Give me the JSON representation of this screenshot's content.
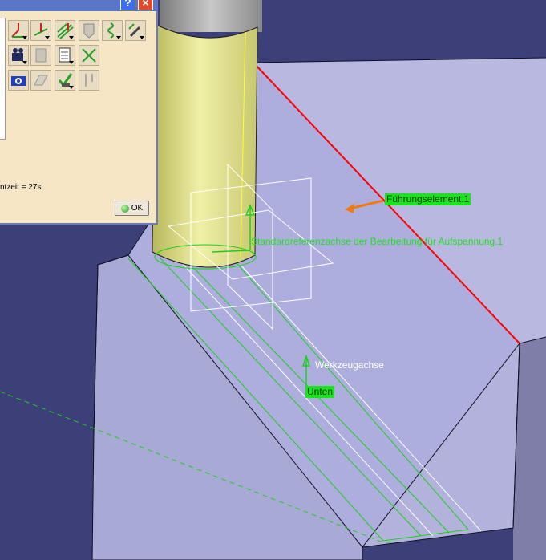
{
  "viewport": {
    "labels": {
      "guide_element": "Führungselement.1",
      "reference_axis": "Standardreferenzachse der Bearbeitung für Aufspannung.1",
      "tool_axis": "Werkzeugachse",
      "bottom": "Unten"
    }
  },
  "panel": {
    "status_text": "ntzeit = 27s",
    "ok_label": "OK",
    "help_label": "?",
    "close_label": "×"
  },
  "colors": {
    "background": "#3c3f78",
    "part_face": "#b9b8e0",
    "highlight_green": "#19e619",
    "guide_edge": "#ff0000",
    "tool_yellow": "#dcdc78",
    "panel_bg": "#f6e6c6"
  }
}
